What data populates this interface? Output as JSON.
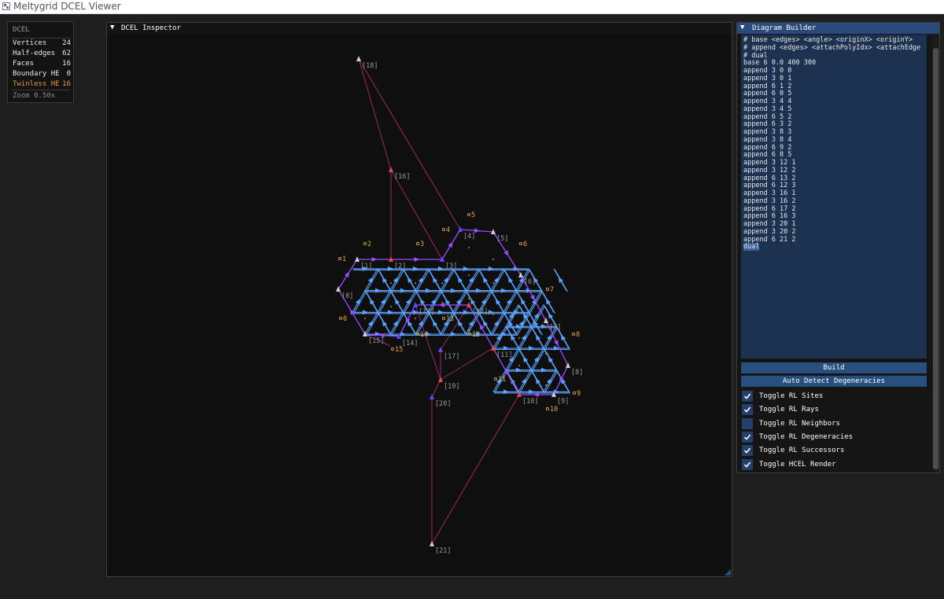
{
  "window": {
    "title": "Meltygrid DCEL Viewer"
  },
  "stats": {
    "header": "DCEL",
    "rows": [
      {
        "label": "Vertices",
        "value": "24"
      },
      {
        "label": "Half-edges",
        "value": "62"
      },
      {
        "label": "Faces",
        "value": "16"
      },
      {
        "label": "Boundary HE",
        "value": "0"
      },
      {
        "label": "Twinless HE",
        "value": "16"
      }
    ],
    "zoom": "Zoom  0.50x"
  },
  "inspector": {
    "title": "DCEL Inspector",
    "toggle_glyph": "▼"
  },
  "builder": {
    "title": "Diagram Builder",
    "toggle_glyph": "▼",
    "script_lines": [
      "# base <edges> <angle> <originX> <originY>",
      "# append <edges> <attachPolyIdx> <attachEdge",
      "# dual",
      "base 6 0.0 400 300",
      "append 3 0 0",
      "append 3 0 1",
      "append 6 1 2",
      "append 6 0 5",
      "append 3 4 4",
      "append 3 4 5",
      "append 6 5 2",
      "append 6 3 2",
      "append 3 8 3",
      "append 3 8 4",
      "append 6 9 2",
      "append 6 8 5",
      "append 3 12 1",
      "append 3 12 2",
      "append 6 13 2",
      "append 6 12 3",
      "append 3 16 1",
      "append 3 16 2",
      "append 6 17 2",
      "append 6 16 3",
      "append 3 20 1",
      "append 3 20 2",
      "append 6 21 2",
      "dual"
    ],
    "build_label": "Build",
    "auto_detect_label": "Auto Detect Degeneracies",
    "toggles": [
      {
        "label": "Toggle RL Sites",
        "checked": true
      },
      {
        "label": "Toggle RL Rays",
        "checked": true
      },
      {
        "label": "Toggle RL Neighbors",
        "checked": false
      },
      {
        "label": "Toggle RL Degeneracies",
        "checked": true
      },
      {
        "label": "Toggle RL Successors",
        "checked": true
      },
      {
        "label": "Toggle HCEL Render",
        "checked": true
      }
    ]
  },
  "scene": {
    "colors": {
      "ray": "#9c2a63",
      "hull": "#9b4dff",
      "inner": "#5ea3ff",
      "site": "#e0a64c",
      "vertex_label": "#9a9a9a"
    },
    "vertex_labels": [
      "[1]",
      "[2]",
      "[3]",
      "[4]",
      "[5]",
      "[6]",
      "[7]",
      "[8]",
      "[9]",
      "[10]",
      "[11]",
      "[12]",
      "[13]",
      "[14]",
      "[15]",
      "[16]",
      "[17]",
      "[18]",
      "[19]",
      "[20]",
      "[21]",
      "[8]"
    ],
    "vertex_tags": [
      "U",
      "R",
      "L",
      "U",
      "U",
      "U",
      "U",
      "R",
      "U",
      "R",
      "R",
      "L",
      "L",
      "R",
      "L",
      "R",
      "U",
      "L",
      "U"
    ],
    "site_labels": [
      "0",
      "1",
      "2",
      "3",
      "4",
      "5",
      "6",
      "7",
      "8",
      "9",
      "10",
      "11",
      "12",
      "13",
      "14",
      "15"
    ]
  }
}
